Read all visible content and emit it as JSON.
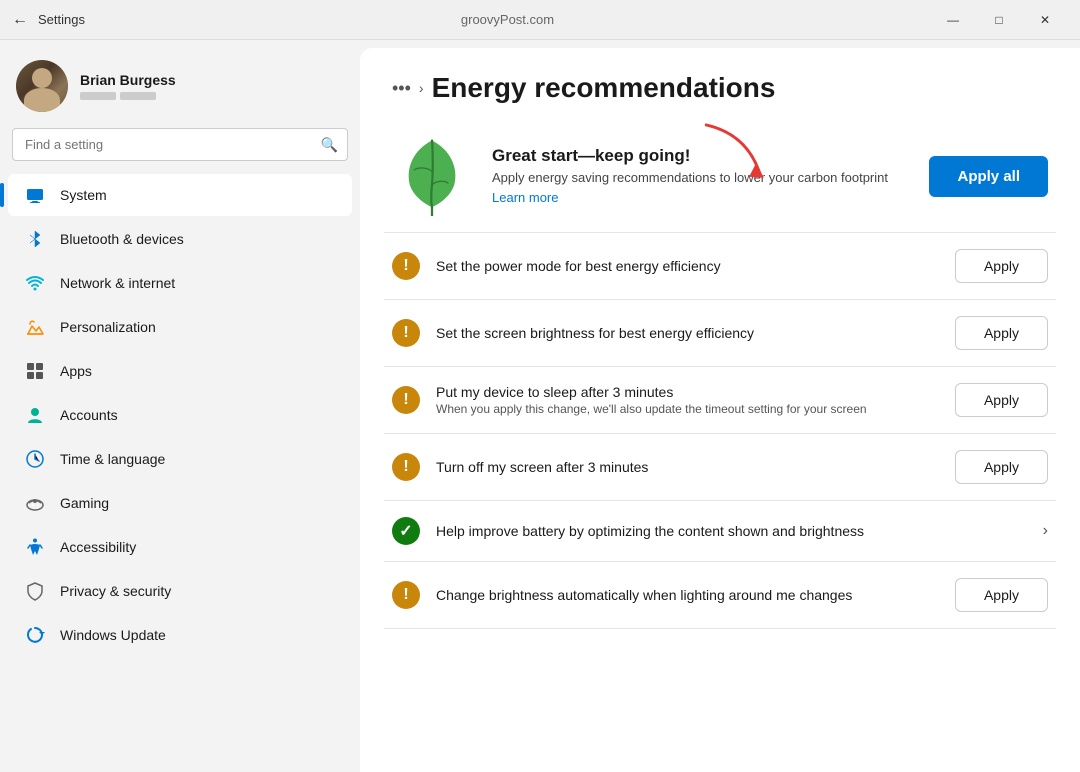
{
  "titlebar": {
    "back_label": "←",
    "app_name": "Settings",
    "center_text": "groovyPost.com",
    "minimize": "—",
    "maximize": "□",
    "close": "✕"
  },
  "sidebar": {
    "user": {
      "name": "Brian Burgess"
    },
    "search": {
      "placeholder": "Find a setting"
    },
    "nav_items": [
      {
        "id": "system",
        "label": "System",
        "active": true
      },
      {
        "id": "bluetooth",
        "label": "Bluetooth & devices",
        "active": false
      },
      {
        "id": "network",
        "label": "Network & internet",
        "active": false
      },
      {
        "id": "personalization",
        "label": "Personalization",
        "active": false
      },
      {
        "id": "apps",
        "label": "Apps",
        "active": false
      },
      {
        "id": "accounts",
        "label": "Accounts",
        "active": false
      },
      {
        "id": "time",
        "label": "Time & language",
        "active": false
      },
      {
        "id": "gaming",
        "label": "Gaming",
        "active": false
      },
      {
        "id": "accessibility",
        "label": "Accessibility",
        "active": false
      },
      {
        "id": "privacy",
        "label": "Privacy & security",
        "active": false
      },
      {
        "id": "update",
        "label": "Windows Update",
        "active": false
      }
    ]
  },
  "content": {
    "breadcrumb_dots": "•••",
    "breadcrumb_arrow": "›",
    "page_title": "Energy recommendations",
    "hero": {
      "title": "Great start—keep going!",
      "description": "Apply energy saving recommendations to lower your carbon footprint",
      "learn_more": "Learn more",
      "apply_all_label": "Apply all"
    },
    "recommendations": [
      {
        "type": "warning",
        "label": "Set the power mode for best energy efficiency",
        "sub": "",
        "action": "apply",
        "apply_label": "Apply"
      },
      {
        "type": "warning",
        "label": "Set the screen brightness for best energy efficiency",
        "sub": "",
        "action": "apply",
        "apply_label": "Apply"
      },
      {
        "type": "warning",
        "label": "Put my device to sleep after 3 minutes",
        "sub": "When you apply this change, we'll also update the timeout setting for your screen",
        "action": "apply",
        "apply_label": "Apply"
      },
      {
        "type": "warning",
        "label": "Turn off my screen after 3 minutes",
        "sub": "",
        "action": "apply",
        "apply_label": "Apply"
      },
      {
        "type": "success",
        "label": "Help improve battery by optimizing the content shown and brightness",
        "sub": "",
        "action": "chevron"
      },
      {
        "type": "warning",
        "label": "Change brightness automatically when lighting around me changes",
        "sub": "",
        "action": "apply",
        "apply_label": "Apply"
      }
    ]
  }
}
